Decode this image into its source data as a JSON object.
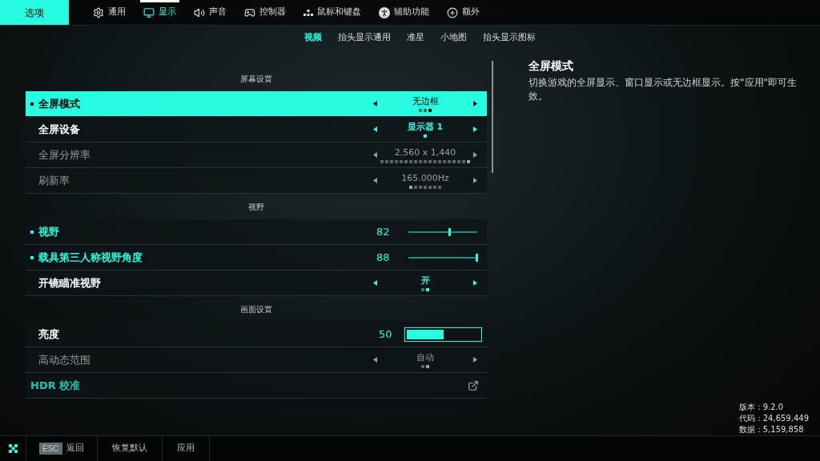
{
  "header": {
    "title": "选项"
  },
  "tabs": [
    {
      "label": "通用",
      "selected": false
    },
    {
      "label": "显示",
      "selected": true
    },
    {
      "label": "声音",
      "selected": false
    },
    {
      "label": "控制器",
      "selected": false
    },
    {
      "label": "鼠标和键盘",
      "selected": false
    },
    {
      "label": "辅助功能",
      "selected": false
    },
    {
      "label": "额外",
      "selected": false
    }
  ],
  "subtabs": [
    {
      "label": "视频",
      "selected": true
    },
    {
      "label": "抬头显示通用",
      "selected": false
    },
    {
      "label": "准星",
      "selected": false
    },
    {
      "label": "小地图",
      "selected": false
    },
    {
      "label": "抬头显示图标",
      "selected": false
    }
  ],
  "sections": [
    {
      "heading": "屏幕设置",
      "rows": [
        {
          "kind": "selector",
          "label": "全屏模式",
          "value": "无边框",
          "selected": true,
          "modified": true,
          "disabled": false,
          "dots": [
            {
              "selected": false
            },
            {
              "selected": false
            },
            {
              "selected": true
            }
          ]
        },
        {
          "kind": "selector",
          "label": "全屏设备",
          "value": "显示器 1",
          "selected": false,
          "modified": false,
          "disabled": false,
          "dots": [
            {
              "selected": true
            }
          ]
        },
        {
          "kind": "selector",
          "label": "全屏分辨率",
          "value": "2,560 x 1,440",
          "selected": false,
          "modified": false,
          "disabled": true,
          "dots": [
            {
              "selected": false
            },
            {
              "selected": false
            },
            {
              "selected": false
            },
            {
              "selected": false
            },
            {
              "selected": false
            },
            {
              "selected": false
            },
            {
              "selected": false
            },
            {
              "selected": false
            },
            {
              "selected": false
            },
            {
              "selected": false
            },
            {
              "selected": false
            },
            {
              "selected": false
            },
            {
              "selected": false
            },
            {
              "selected": false
            },
            {
              "selected": false
            },
            {
              "selected": false
            },
            {
              "selected": false
            },
            {
              "selected": false
            },
            {
              "selected": true
            }
          ]
        },
        {
          "kind": "selector",
          "label": "刷新率",
          "value": "165.000Hz",
          "selected": false,
          "modified": false,
          "disabled": true,
          "dots": [
            {
              "selected": true
            },
            {
              "selected": false
            },
            {
              "selected": false
            },
            {
              "selected": false
            },
            {
              "selected": false
            },
            {
              "selected": false
            },
            {
              "selected": false
            }
          ]
        }
      ]
    },
    {
      "heading": "视野",
      "rows": [
        {
          "kind": "slider",
          "label": "视野",
          "value": "82",
          "level": 0.61,
          "selected": false,
          "modified": true,
          "disabled": false
        },
        {
          "kind": "slider",
          "label": "载具第三人称视野角度",
          "value": "88",
          "level": 1,
          "selected": false,
          "modified": true,
          "disabled": false
        },
        {
          "kind": "selector",
          "label": "开镜瞄准视野",
          "value": "开",
          "selected": false,
          "modified": false,
          "disabled": false,
          "dots": [
            {
              "selected": false
            },
            {
              "selected": true
            }
          ]
        }
      ]
    },
    {
      "heading": "画面设置",
      "rows": [
        {
          "kind": "bar",
          "label": "亮度",
          "value": "50",
          "level": 0.5,
          "selected": false,
          "modified": false,
          "disabled": false
        },
        {
          "kind": "selector",
          "label": "高动态范围",
          "value": "自动",
          "selected": false,
          "modified": false,
          "disabled": true,
          "dots": [
            {
              "selected": false
            },
            {
              "selected": true
            }
          ]
        },
        {
          "kind": "link",
          "label": "HDR 校准",
          "selected": false,
          "modified": false,
          "disabled": false
        }
      ]
    }
  ],
  "description": {
    "title": "全屏模式",
    "text": "切换游戏的全屏显示、窗口显示或无边框显示。按\"应用\"即可生效。"
  },
  "build_info": [
    "版本：9.2.0",
    "代码：24,659,449",
    "数据：5,159,858"
  ],
  "footer": {
    "key": "ESC",
    "back": "返回",
    "buttons": [
      "恢复默认",
      "应用"
    ]
  }
}
